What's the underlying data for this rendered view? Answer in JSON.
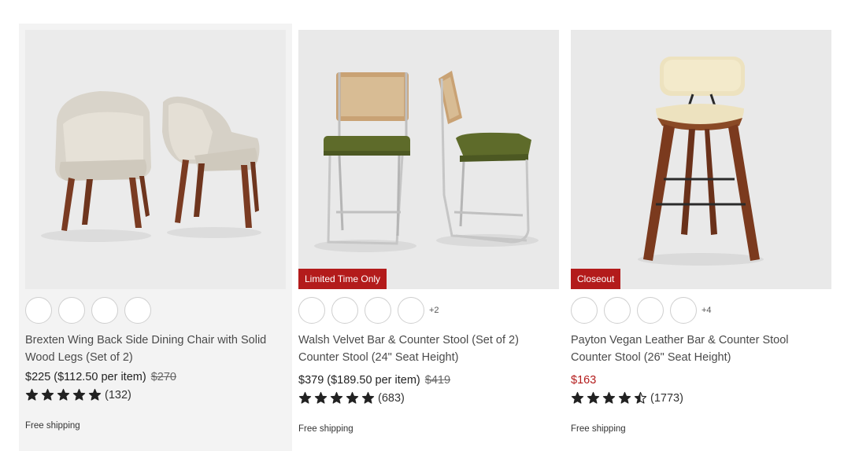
{
  "products": [
    {
      "name": "Brexten Wing Back Side Dining Chair with Solid Wood Legs (Set of 2)",
      "price": "$225 ($112.50 per item)",
      "was_price": "$270",
      "rating_count": "(132)",
      "rating_value": 5,
      "shipping": "Free shipping",
      "badge": "",
      "more_swatches": ""
    },
    {
      "name": "Walsh Velvet Bar & Counter Stool (Set of 2) Counter Stool (24\" Seat Height)",
      "price": "$379 ($189.50 per item)",
      "was_price": "$419",
      "rating_count": "(683)",
      "rating_value": 5,
      "shipping": "Free shipping",
      "badge": "Limited Time Only",
      "more_swatches": "+2"
    },
    {
      "name": "Payton Vegan Leather Bar & Counter Stool Counter Stool (26\" Seat Height)",
      "price": "$163",
      "was_price": "",
      "rating_count": "(1773)",
      "rating_value": 4.5,
      "shipping": "Free shipping",
      "badge": "Closeout",
      "more_swatches": "+4"
    }
  ],
  "colors": {
    "badge": "#b31b1b",
    "sale_price": "#b31b1b",
    "star": "#222222",
    "highlight_card": "#f3f3f3"
  }
}
